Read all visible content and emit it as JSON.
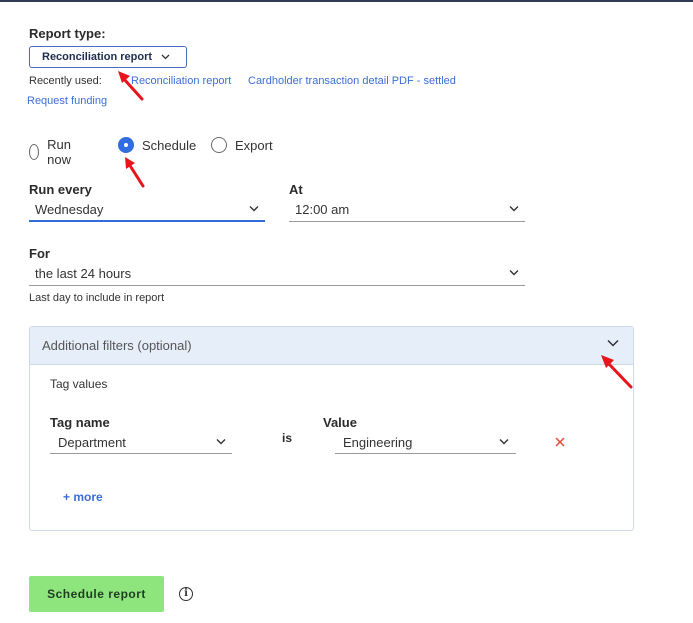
{
  "report_type": {
    "label": "Report type:",
    "selected": "Reconciliation report",
    "recently_used_label": "Recently used:",
    "recent": [
      "Reconciliation report",
      "Cardholder transaction detail PDF - settled",
      "Request funding"
    ]
  },
  "run_mode": {
    "options": [
      "Run now",
      "Schedule",
      "Export"
    ],
    "selected": "Schedule"
  },
  "schedule": {
    "run_every_label": "Run every",
    "run_every_value": "Wednesday",
    "at_label": "At",
    "at_value": "12:00 am",
    "for_label": "For",
    "for_value": "the last 24 hours",
    "for_hint": "Last day to include in report"
  },
  "filters": {
    "title": "Additional filters (optional)",
    "section": "Tag values",
    "tag_name_label": "Tag name",
    "tag_name_value": "Department",
    "operator": "is",
    "value_label": "Value",
    "value_value": "Engineering",
    "more_label": "+ more"
  },
  "actions": {
    "submit_label": "Schedule report",
    "info_glyph": "i"
  },
  "colors": {
    "accent": "#2f6de0",
    "link": "#3b6fd8",
    "primary_button": "#8ee57d",
    "remove_icon": "#e0483a",
    "annotation_arrow": "#e8141b"
  }
}
